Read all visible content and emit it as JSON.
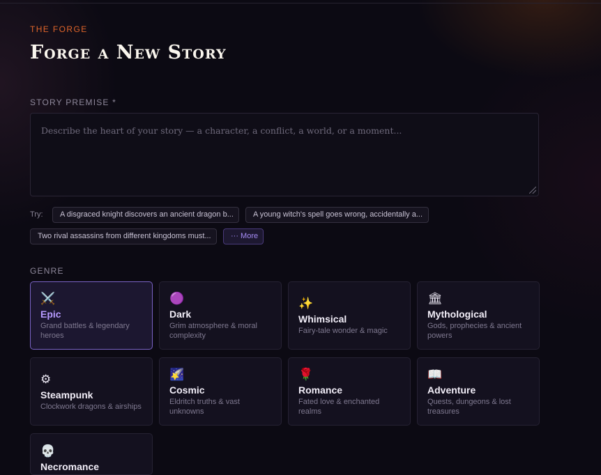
{
  "header": {
    "eyebrow": "THE FORGE",
    "title": "Forge a New Story"
  },
  "premise": {
    "label": "STORY PREMISE *",
    "placeholder": "Describe the heart of your story — a character, a conflict, a world, or a moment..."
  },
  "suggestions": {
    "try_label": "Try:",
    "chips": [
      "A disgraced knight discovers an ancient dragon b...",
      "A young witch's spell goes wrong, accidentally a...",
      "Two rival assassins from different kingdoms must..."
    ],
    "more_label": "··· More"
  },
  "genre": {
    "label": "GENRE",
    "selected": "Epic",
    "cards": [
      {
        "name": "Epic",
        "desc": "Grand battles & legendary heroes",
        "icon": "crossed-swords-icon",
        "glyph": "⚔️"
      },
      {
        "name": "Dark",
        "desc": "Grim atmosphere & moral complexity",
        "icon": "purple-orb-icon",
        "glyph": "🟣"
      },
      {
        "name": "Whimsical",
        "desc": "Fairy-tale wonder & magic",
        "icon": "sparkles-icon",
        "glyph": "✨"
      },
      {
        "name": "Mythological",
        "desc": "Gods, prophecies & ancient powers",
        "icon": "temple-icon",
        "glyph": "🏛"
      },
      {
        "name": "Steampunk",
        "desc": "Clockwork dragons & airships",
        "icon": "gear-icon",
        "glyph": "⚙"
      },
      {
        "name": "Cosmic",
        "desc": "Eldritch truths & vast unknowns",
        "icon": "comet-icon",
        "glyph": "🌠"
      },
      {
        "name": "Romance",
        "desc": "Fated love & enchanted realms",
        "icon": "rose-icon",
        "glyph": "🌹"
      },
      {
        "name": "Adventure",
        "desc": "Quests, dungeons & lost treasures",
        "icon": "map-book-icon",
        "glyph": "📖"
      },
      {
        "name": "Necromance",
        "desc": "",
        "icon": "skull-icon",
        "glyph": "💀"
      }
    ]
  },
  "colors": {
    "accent": "#e0652a",
    "selected_border": "#7a63c6",
    "selected_text": "#b79bff",
    "background": "#0c0a13"
  }
}
